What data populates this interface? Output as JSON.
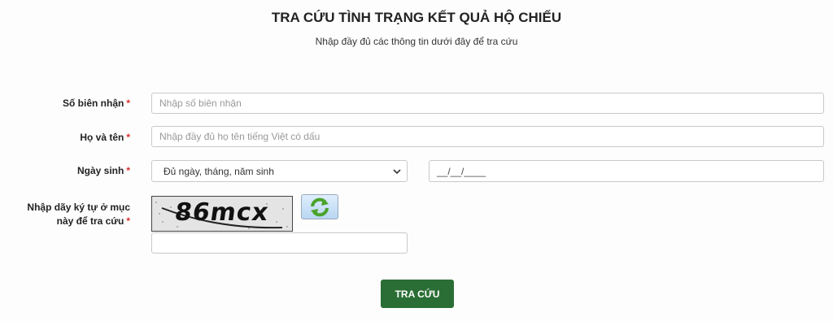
{
  "header": {
    "title": "TRA CỨU TÌNH TRẠNG KẾT QUẢ HỘ CHIẾU",
    "subtitle": "Nhập đầy đủ các thông tin dưới đây để tra cứu"
  },
  "form": {
    "required_mark": "*",
    "receipt": {
      "label": "Số biên nhận",
      "placeholder": "Nhập số biên nhận",
      "value": ""
    },
    "fullname": {
      "label": "Họ và tên",
      "placeholder": "Nhập đầy đủ họ tên tiếng Việt có dấu",
      "value": ""
    },
    "dob": {
      "label": "Ngày sinh",
      "selected_option": "Đủ ngày, tháng, năm sinh",
      "date_mask": "__/__/____"
    },
    "captcha": {
      "label_line1": "Nhập dãy ký tự ở mục",
      "label_line2": "này để tra cứu",
      "image_text": "86mcx",
      "refresh_icon": "refresh-icon",
      "value": ""
    },
    "submit_label": "TRA CỨU"
  },
  "colors": {
    "required": "#d9302c",
    "submit_bg": "#2a6e35",
    "refresh_green": "#4aa32a"
  }
}
